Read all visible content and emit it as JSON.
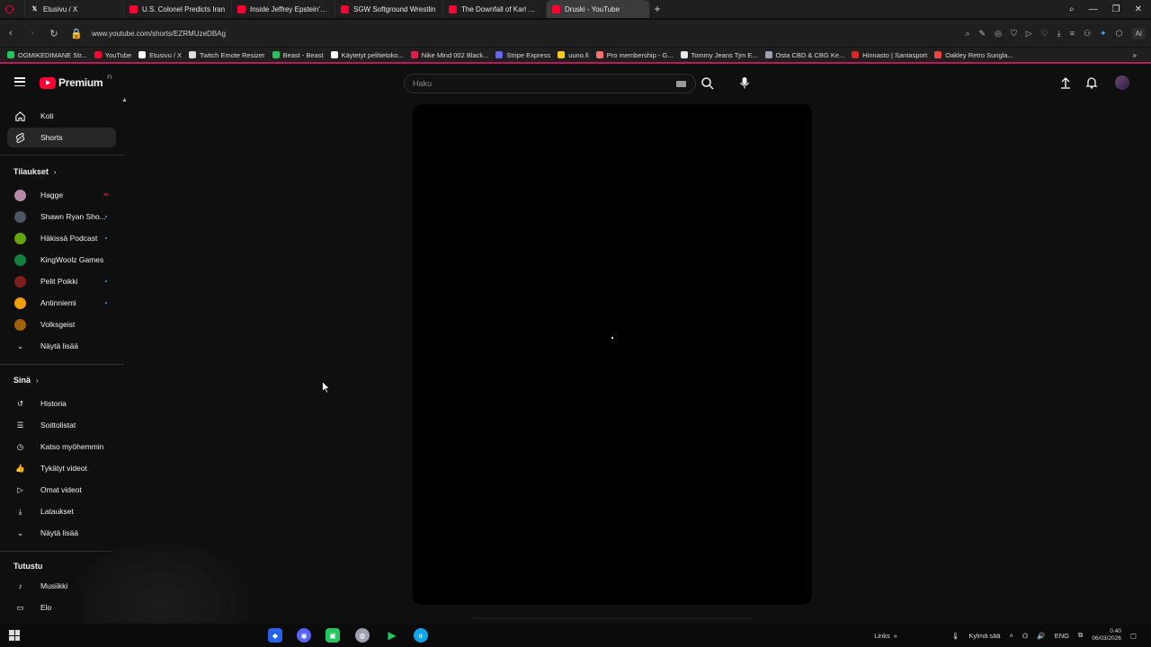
{
  "browser": {
    "tabs": [
      {
        "label": "Etusivu / X",
        "favicon": "x-icon",
        "active": false
      },
      {
        "label": "U.S. Colonel Predicts Iran",
        "favicon": "youtube-icon",
        "active": false
      },
      {
        "label": "Inside Jeffrey Epstein's 'G",
        "favicon": "youtube-icon",
        "active": false
      },
      {
        "label": "SGW Softground Wrestlin",
        "favicon": "youtube-icon",
        "active": false
      },
      {
        "label": "The Downfall of Karl Malo",
        "favicon": "youtube-icon",
        "active": false
      },
      {
        "label": "Druski - YouTube",
        "favicon": "youtube-icon",
        "active": true
      }
    ],
    "new_tab": "+",
    "url": "www.youtube.com/shorts/EZRMUzeDBAg",
    "ai_label": "AI",
    "bookmarks": [
      {
        "label": "OGMIKEDIMANE Str...",
        "color": "#22c55e"
      },
      {
        "label": "YouTube",
        "color": "#ff0033"
      },
      {
        "label": "Etusivu / X",
        "color": "#ffffff"
      },
      {
        "label": "Twitch Emote Resizer",
        "color": "#dddddd"
      },
      {
        "label": "Beast - Beast",
        "color": "#22c55e"
      },
      {
        "label": "Käytetyt pelitietoko...",
        "color": "#ffffff"
      },
      {
        "label": "Nike Mind 002 Black...",
        "color": "#e11d48"
      },
      {
        "label": "Stripe Express",
        "color": "#6366f1"
      },
      {
        "label": "uuno.fi",
        "color": "#facc15"
      },
      {
        "label": "Pro membership - G...",
        "color": "#f87171"
      },
      {
        "label": "Tommy Jeans Tjm E...",
        "color": "#e5e7eb"
      },
      {
        "label": "Osta CBD & CBG Ke...",
        "color": "#9ca3af"
      },
      {
        "label": "Hinnasto | Santasport",
        "color": "#dc2626"
      },
      {
        "label": "Oakley Retro Sungla...",
        "color": "#ef4444"
      }
    ],
    "bookmarks_more": "»"
  },
  "youtube": {
    "logo_text": "Premium",
    "logo_sup": "FI",
    "search_placeholder": "Haku"
  },
  "sidebar": {
    "main": [
      {
        "label": "Koti",
        "icon": "home-icon",
        "active": false
      },
      {
        "label": "Shorts",
        "icon": "shorts-icon",
        "active": true
      }
    ],
    "subscriptions_title": "Tilaukset",
    "subscriptions": [
      {
        "label": "Hagge",
        "color": "#b48aa5",
        "marker": "live"
      },
      {
        "label": "Shawn Ryan Sho...",
        "color": "#4b5563",
        "marker": "dot"
      },
      {
        "label": "Häkissä Podcast",
        "color": "#65a30d",
        "marker": "dot"
      },
      {
        "label": "KingWoolz Games",
        "color": "#15803d",
        "marker": "none"
      },
      {
        "label": "Pelit Poikki",
        "color": "#7f1d1d",
        "marker": "dot"
      },
      {
        "label": "Antinniemi",
        "color": "#f59e0b",
        "marker": "dot"
      },
      {
        "label": "Volksgeist",
        "color": "#a16207",
        "marker": "none"
      }
    ],
    "subscriptions_more": "Näytä lisää",
    "you_title": "Sinä",
    "you": [
      {
        "label": "Historia",
        "icon": "history-icon"
      },
      {
        "label": "Soittolistat",
        "icon": "playlists-icon"
      },
      {
        "label": "Katso myöhemmin",
        "icon": "watch-later-icon"
      },
      {
        "label": "Tykätyt videot",
        "icon": "liked-icon"
      },
      {
        "label": "Omat videot",
        "icon": "your-videos-icon"
      },
      {
        "label": "Lataukset",
        "icon": "downloads-icon"
      }
    ],
    "you_more": "Näytä lisää",
    "explore_title": "Tutustu",
    "explore": [
      {
        "label": "Musiikki",
        "icon": "music-icon"
      },
      {
        "label": "Elo",
        "icon": "movies-icon"
      }
    ]
  },
  "taskbar": {
    "links_label": "Links",
    "weather": "Kylmä sää",
    "language": "ENG",
    "time": "0.40",
    "date": "06/03/2026"
  }
}
